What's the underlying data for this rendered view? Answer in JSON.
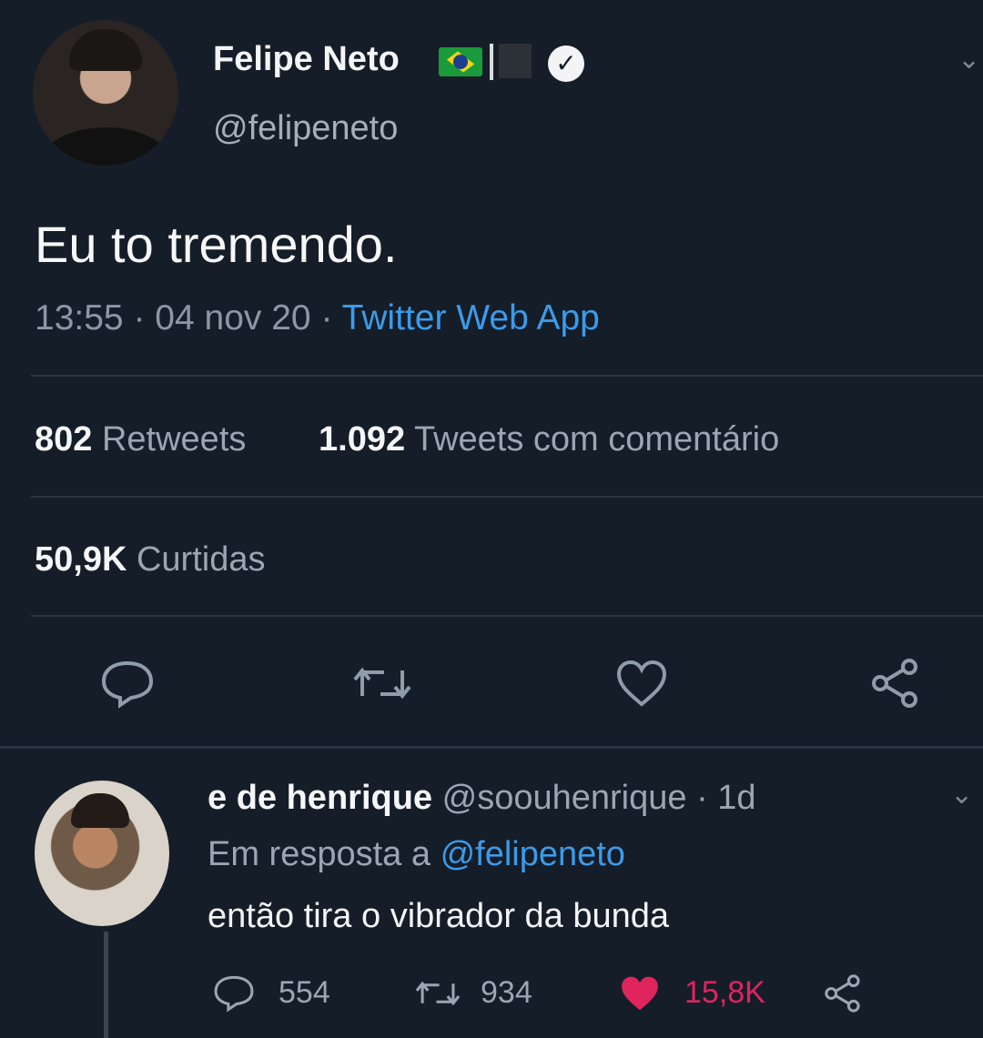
{
  "tweet": {
    "author_name": "Felipe Neto",
    "author_handle": "@felipeneto",
    "text": "Eu to tremendo.",
    "time": "13:55",
    "date": "04 nov 20",
    "separator": "·",
    "source": "Twitter Web App",
    "retweets_count": "802",
    "retweets_label": "Retweets",
    "quotes_count": "1.092",
    "quotes_label": "Tweets com comentário",
    "likes_count": "50,9K",
    "likes_label": "Curtidas"
  },
  "reply": {
    "author_name": "e de henrique",
    "author_handle": "@soouhenrique",
    "age": "1d",
    "in_reply_label": "Em resposta a",
    "in_reply_to": "@felipeneto",
    "text": "então tira o vibrador da bunda",
    "reply_count": "554",
    "retweet_count": "934",
    "like_count": "15,8K"
  },
  "colors": {
    "background": "#151d28",
    "link": "#3b9bea",
    "like_active": "#e0245e"
  },
  "icons": {
    "verified": "verified-check-icon",
    "flag": "brazil-flag-icon",
    "reply": "speech-bubble-icon",
    "retweet": "retweet-icon",
    "like": "heart-icon",
    "share": "share-icon",
    "caret": "chevron-down-icon"
  }
}
